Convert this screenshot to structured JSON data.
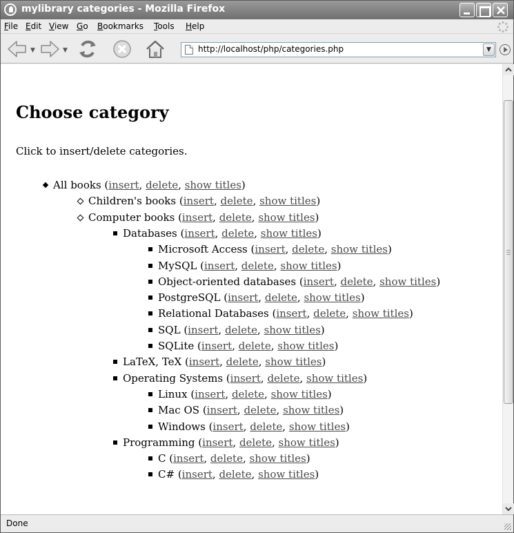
{
  "window": {
    "title": "mylibrary categories - Mozilla Firefox"
  },
  "menu": {
    "items": [
      {
        "key": "F",
        "rest": "ile"
      },
      {
        "key": "E",
        "rest": "dit"
      },
      {
        "key": "V",
        "rest": "iew"
      },
      {
        "key": "G",
        "rest": "o"
      },
      {
        "key": "B",
        "rest": "ookmarks"
      },
      {
        "key": "T",
        "rest": "ools"
      },
      {
        "key": "H",
        "rest": "elp"
      }
    ]
  },
  "toolbar": {
    "url": "http://localhost/php/categories.php",
    "go_label": "Go",
    "icons": [
      "back-icon",
      "forward-icon",
      "reload-icon",
      "stop-icon",
      "home-icon"
    ]
  },
  "page": {
    "heading": "Choose category",
    "intro": "Click to insert/delete categories.",
    "action_labels": {
      "insert": "insert",
      "delete": "delete",
      "show": "show titles"
    },
    "categories": [
      {
        "name": "All books",
        "level": 0
      },
      {
        "name": "Children's books",
        "level": 1
      },
      {
        "name": "Computer books",
        "level": 1
      },
      {
        "name": "Databases",
        "level": 2
      },
      {
        "name": "Microsoft Access",
        "level": 3
      },
      {
        "name": "MySQL",
        "level": 3
      },
      {
        "name": "Object-oriented databases",
        "level": 3
      },
      {
        "name": "PostgreSQL",
        "level": 3
      },
      {
        "name": "Relational Databases",
        "level": 3
      },
      {
        "name": "SQL",
        "level": 3
      },
      {
        "name": "SQLite",
        "level": 3
      },
      {
        "name": "LaTeX, TeX",
        "level": 2
      },
      {
        "name": "Operating Systems",
        "level": 2
      },
      {
        "name": "Linux",
        "level": 3
      },
      {
        "name": "Mac OS",
        "level": 3
      },
      {
        "name": "Windows",
        "level": 3
      },
      {
        "name": "Programming",
        "level": 2
      },
      {
        "name": "C",
        "level": 3
      },
      {
        "name": "C#",
        "level": 3
      }
    ]
  },
  "status": {
    "text": "Done"
  },
  "colors": {
    "titlebar": "#808080",
    "link": "#4a4a4a",
    "chrome": "#ececec"
  }
}
